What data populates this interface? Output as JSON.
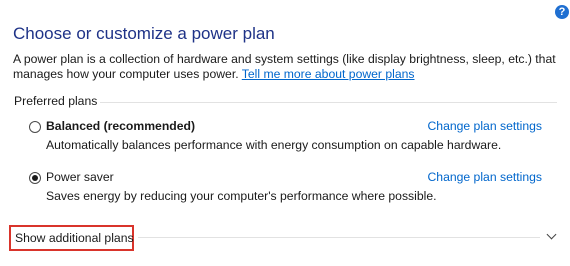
{
  "header": {
    "title": "Choose or customize a power plan",
    "help_icon": "?"
  },
  "intro": {
    "text": "A power plan is a collection of hardware and system settings (like display brightness, sleep, etc.) that manages how your computer uses power.",
    "link": "Tell me more about power plans"
  },
  "preferred": {
    "label": "Preferred plans",
    "plans": [
      {
        "name": "Balanced (recommended)",
        "selected": false,
        "link": "Change plan settings",
        "description": "Automatically balances performance with energy consumption on capable hardware."
      },
      {
        "name": "Power saver",
        "selected": true,
        "link": "Change plan settings",
        "description": "Saves energy by reducing your computer's performance where possible."
      }
    ]
  },
  "additional": {
    "label": "Show additional plans",
    "chevron_icon": "chevron-down-icon"
  },
  "colors": {
    "title": "#1e3287",
    "link": "#0066cc",
    "highlight": "#d9342b"
  }
}
